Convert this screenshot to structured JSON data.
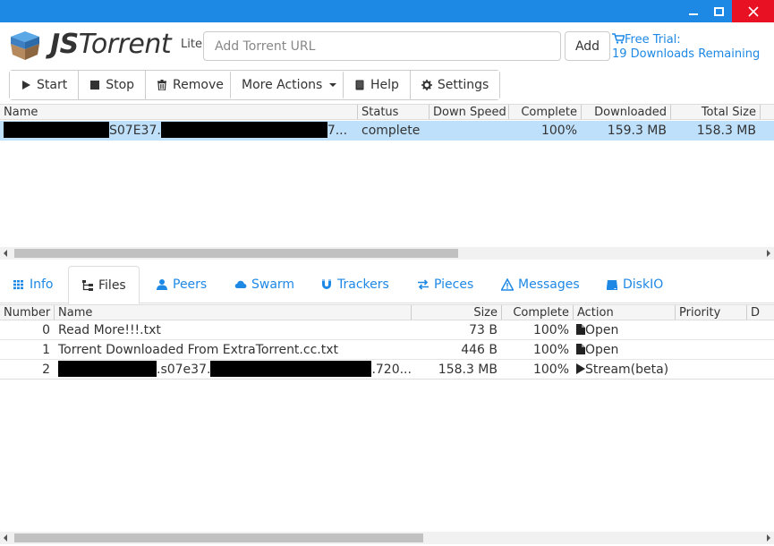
{
  "app": {
    "brand_js": "JS",
    "brand_torrent": "Torrent",
    "edition": "Lite"
  },
  "header": {
    "url_placeholder": "Add Torrent URL",
    "add_label": "Add",
    "trial_line1": "Free Trial:",
    "trial_line2": "19 Downloads Remaining"
  },
  "toolbar": {
    "start": "Start",
    "stop": "Stop",
    "remove": "Remove",
    "more_actions": "More Actions",
    "help": "Help",
    "settings": "Settings"
  },
  "torrents": {
    "columns": [
      "Name",
      "Status",
      "Down Speed",
      "Complete",
      "Downloaded",
      "Total Size"
    ],
    "rows": [
      {
        "name_mid": "S07E37.",
        "name_end": "7...",
        "status": "complete",
        "down_speed": "",
        "complete": "100%",
        "downloaded": "159.3 MB",
        "total_size": "158.3 MB"
      }
    ]
  },
  "tabs": [
    "Info",
    "Files",
    "Peers",
    "Swarm",
    "Trackers",
    "Pieces",
    "Messages",
    "DiskIO"
  ],
  "files": {
    "columns": [
      "Number",
      "Name",
      "Size",
      "Complete",
      "Action",
      "Priority",
      "D"
    ],
    "rows": [
      {
        "number": "0",
        "name": "Read More!!!.txt",
        "size": "73 B",
        "complete": "100%",
        "action": "Open"
      },
      {
        "number": "1",
        "name": "Torrent Downloaded From ExtraTorrent.cc.txt",
        "size": "446 B",
        "complete": "100%",
        "action": "Open"
      },
      {
        "number": "2",
        "name_mid": ".s07e37.",
        "name_end": ".720...",
        "size": "158.3 MB",
        "complete": "100%",
        "action": "Stream(beta)"
      }
    ]
  },
  "colors": {
    "titlebar": "#1e88e5",
    "accent": "#1e88e5",
    "selected_row": "#bfe0fb",
    "close": "#e81123"
  }
}
